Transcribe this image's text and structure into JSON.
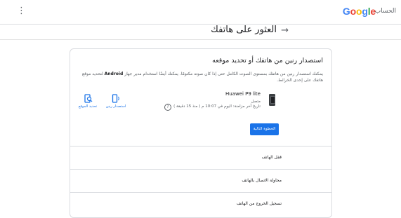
{
  "header": {
    "logo_letters": [
      {
        "ch": "G",
        "color": "#4285F4"
      },
      {
        "ch": "o",
        "color": "#EA4335"
      },
      {
        "ch": "o",
        "color": "#FBBC05"
      },
      {
        "ch": "g",
        "color": "#4285F4"
      },
      {
        "ch": "l",
        "color": "#34A853"
      },
      {
        "ch": "e",
        "color": "#EA4335"
      }
    ],
    "account_label": "الحساب",
    "apps_icon": "more-vert-icon"
  },
  "page": {
    "back_icon": "→",
    "title": "العثور على هاتفك"
  },
  "card": {
    "title": "استصدار رنين من هاتفك أو تحديد موقعه",
    "description_pre": "يمكنك استصدار رنين من هاتفك بمستوى الصوت الكامل حتى إذا كان صوته مكتومًا. يمكنك أيضًا استخدام مدير جهاز",
    "description_bold": "Android",
    "description_post": "لتحديد موقع هاتفك على إحدى الخرائط.",
    "device": {
      "name": "Huawei P9 lite",
      "status": "متصل",
      "last_sync": "تاريخ آخر مزامنة: اليوم في 10:07 م ( منذ 15 دقيقة )"
    },
    "actions": {
      "ring_label": "استصدار رنين",
      "locate_label": "تحديد الموقع"
    },
    "next_button": "الخطوة التالية",
    "rows": [
      "قفل الهاتف",
      "محاولة الاتصال بالهاتف",
      "تسجيل الخروج من الهاتف"
    ]
  }
}
